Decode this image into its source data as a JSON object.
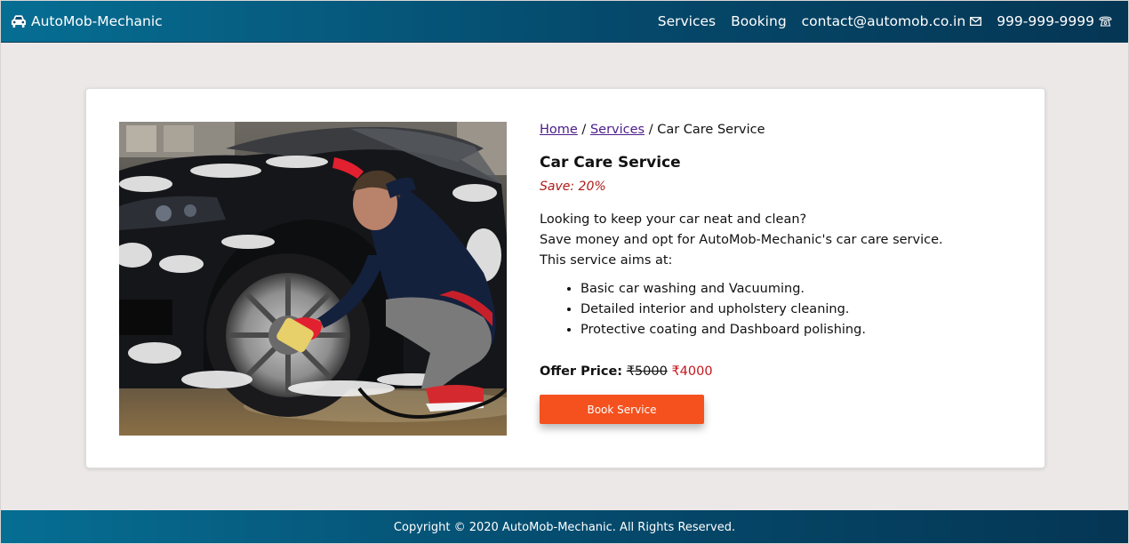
{
  "navbar": {
    "brand": "AutoMob-Mechanic",
    "brand_icon": "car-icon",
    "links": {
      "services": "Services",
      "booking": "Booking",
      "email": "contact@automob.co.in",
      "email_icon": "envelope-icon",
      "phone": "999-999-9999",
      "phone_icon": "telephone-icon"
    }
  },
  "breadcrumb": {
    "home": "Home",
    "sep1": " / ",
    "services": "Services",
    "sep2": " / ",
    "current": "Car Care Service"
  },
  "service": {
    "title": "Car Care Service",
    "save": "Save: 20%",
    "desc_line1": "Looking to keep your car neat and clean?",
    "desc_line2": "Save money and opt for AutoMob-Mechanic's car care service.",
    "desc_line3": "This service aims at:",
    "bullets": [
      "Basic car washing and Vacuuming.",
      "Detailed interior and upholstery cleaning.",
      "Protective coating and Dashboard polishing."
    ],
    "price_label": "Offer Price:",
    "old_price": "₹5000",
    "new_price": "₹4000",
    "book_button": "Book Service",
    "image_alt": "Man washing a car wheel covered in foam"
  },
  "footer": {
    "copyright": "Copyright © 2020 AutoMob-Mechanic. All Rights Reserved."
  },
  "colors": {
    "nav_gradient_start": "#066e93",
    "nav_gradient_end": "#053654",
    "page_bg": "#ede8e8",
    "button": "#f4511e",
    "save_text": "#b01a1a",
    "new_price": "#c4161c",
    "link": "#4b1c8a"
  }
}
